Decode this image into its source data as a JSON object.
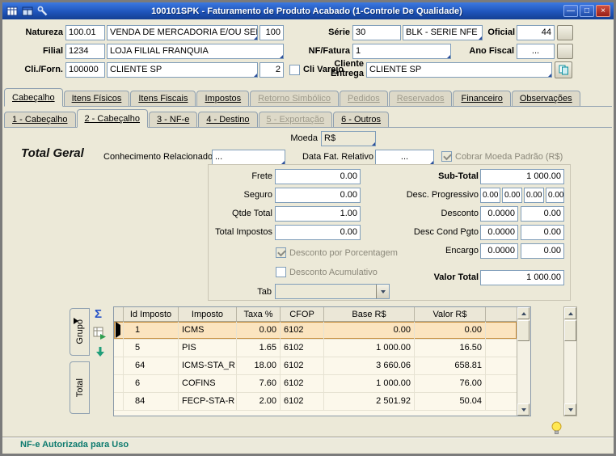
{
  "window": {
    "title": "100101SPK - Faturamento de Produto Acabado (1-Controle De Qualidade)",
    "controls": {
      "minimize": "—",
      "maximize": "□",
      "close": "×"
    }
  },
  "form": {
    "natureza": {
      "label": "Natureza",
      "code": "100.01",
      "desc": "VENDA DE MERCADORIA E/OU SERVI",
      "extra": "100"
    },
    "serie": {
      "label": "Série",
      "code": "30",
      "desc": "BLK - SERIE NFE"
    },
    "oficial": {
      "label": "Oficial",
      "value": "44"
    },
    "filial": {
      "label": "Filial",
      "code": "1234",
      "desc": "LOJA FILIAL FRANQUIA"
    },
    "nf_fatura": {
      "label": "NF/Fatura",
      "value": "1"
    },
    "ano_fiscal": {
      "label": "Ano Fiscal",
      "value": "..."
    },
    "cli_forn": {
      "label": "Cli./Forn.",
      "code": "100000",
      "desc": "CLIENTE SP",
      "extra": "2"
    },
    "cli_varejo_label": "Cli Varejo",
    "cliente_entrega": {
      "label_line1": "Cliente",
      "label_line2": "Entrega",
      "value": "CLIENTE SP"
    }
  },
  "tabs_main": [
    {
      "label": "Cabeçalho",
      "state": "active"
    },
    {
      "label": "Itens Físicos",
      "state": "normal"
    },
    {
      "label": "Itens Fiscais",
      "state": "normal"
    },
    {
      "label": "Impostos",
      "state": "normal"
    },
    {
      "label": "Retorno Simbólico",
      "state": "disabled"
    },
    {
      "label": "Pedidos",
      "state": "disabled"
    },
    {
      "label": "Reservados",
      "state": "disabled"
    },
    {
      "label": "Financeiro",
      "state": "normal"
    },
    {
      "label": "Observações",
      "state": "normal"
    }
  ],
  "tabs_sub": [
    {
      "label": "1 - Cabeçalho",
      "state": "normal"
    },
    {
      "label": "2 - Cabeçalho",
      "state": "active"
    },
    {
      "label": "3 - NF-e",
      "state": "normal"
    },
    {
      "label": "4 - Destino",
      "state": "normal"
    },
    {
      "label": "5 - Exportação",
      "state": "disabled"
    },
    {
      "label": "6 - Outros",
      "state": "normal"
    }
  ],
  "page": {
    "total_geral": "Total Geral",
    "moeda": {
      "label": "Moeda",
      "value": "R$"
    },
    "conhecimento": {
      "label": "Conhecimento Relacionado",
      "value": "..."
    },
    "data_fat": {
      "label": "Data Fat. Relativo",
      "value": "..."
    },
    "cobrar_moeda_label": "Cobrar Moeda Padrão (R$)",
    "frete": {
      "label": "Frete",
      "value": "0.00"
    },
    "seguro": {
      "label": "Seguro",
      "value": "0.00"
    },
    "qtde_total": {
      "label": "Qtde Total",
      "value": "1.00"
    },
    "total_impostos": {
      "label": "Total Impostos",
      "value": "0.00"
    },
    "desconto_porcentagem_label": "Desconto por Porcentagem",
    "desconto_acumulativo_label": "Desconto Acumulativo",
    "tab_combo_label": "Tab",
    "sub_total": {
      "label": "Sub-Total",
      "value": "1 000.00"
    },
    "desc_progressivo": {
      "label": "Desc. Progressivo",
      "values": [
        "0.00",
        "0.00",
        "0.00",
        "0.00"
      ]
    },
    "desconto": {
      "label": "Desconto",
      "pct": "0.0000",
      "value": "0.00"
    },
    "desc_cond_pgto": {
      "label": "Desc Cond Pgto",
      "pct": "0.0000",
      "value": "0.00"
    },
    "encargo": {
      "label": "Encargo",
      "pct": "0.0000",
      "value": "0.00"
    },
    "valor_total": {
      "label": "Valor Total",
      "value": "1 000.00"
    }
  },
  "icons": {
    "sigma": "Σ"
  },
  "grid": {
    "side_tabs": [
      "Grupo",
      "Total"
    ],
    "columns": [
      "Id Imposto",
      "Imposto",
      "Taxa %",
      "CFOP",
      "Base R$",
      "Valor R$"
    ],
    "rows": [
      [
        "1",
        "ICMS",
        "0.00",
        "6102",
        "0.00",
        "0.00"
      ],
      [
        "5",
        "PIS",
        "1.65",
        "6102",
        "1 000.00",
        "16.50"
      ],
      [
        "64",
        "ICMS-STA_R",
        "18.00",
        "6102",
        "3 660.06",
        "658.81"
      ],
      [
        "6",
        "COFINS",
        "7.60",
        "6102",
        "1 000.00",
        "76.00"
      ],
      [
        "84",
        "FECP-STA-R",
        "2.00",
        "6102",
        "2 501.92",
        "50.04"
      ]
    ],
    "selected_row_index": 0
  },
  "statusbar": {
    "message": "NF-e Autorizada para Uso"
  }
}
